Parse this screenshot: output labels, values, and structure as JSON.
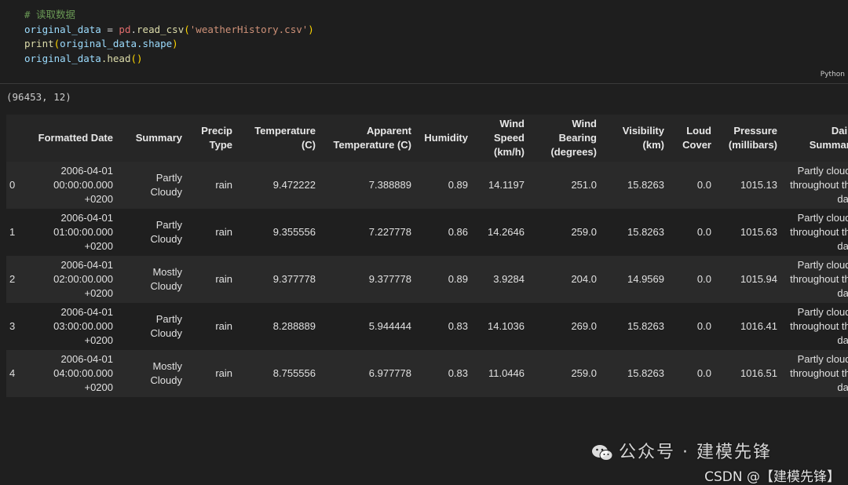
{
  "code": {
    "comment": "# 读取数据",
    "line1": {
      "var": "original_data",
      "op": " = ",
      "mod": "pd",
      "dot": ".",
      "fn": "read_csv",
      "arg": "'weatherHistory.csv'"
    },
    "line2": {
      "fn": "print",
      "var": "original_data",
      "attr": ".shape"
    },
    "line3": {
      "var": "original_data",
      "method": ".head",
      "call": "()"
    },
    "language": "Python"
  },
  "output": {
    "shape": "(96453, 12)",
    "columns": [
      "",
      "Formatted Date",
      "Summary",
      "Precip Type",
      "Temperature (C)",
      "Apparent Temperature (C)",
      "Humidity",
      "Wind Speed (km/h)",
      "Wind Bearing (degrees)",
      "Visibility (km)",
      "Loud Cover",
      "Pressure (millibars)",
      "Daily Summary"
    ],
    "rows": [
      [
        "0",
        "2006-04-01 00:00:00.000 +0200",
        "Partly Cloudy",
        "rain",
        "9.472222",
        "7.388889",
        "0.89",
        "14.1197",
        "251.0",
        "15.8263",
        "0.0",
        "1015.13",
        "Partly cloudy throughout the day."
      ],
      [
        "1",
        "2006-04-01 01:00:00.000 +0200",
        "Partly Cloudy",
        "rain",
        "9.355556",
        "7.227778",
        "0.86",
        "14.2646",
        "259.0",
        "15.8263",
        "0.0",
        "1015.63",
        "Partly cloudy throughout the day."
      ],
      [
        "2",
        "2006-04-01 02:00:00.000 +0200",
        "Mostly Cloudy",
        "rain",
        "9.377778",
        "9.377778",
        "0.89",
        "3.9284",
        "204.0",
        "14.9569",
        "0.0",
        "1015.94",
        "Partly cloudy throughout the day."
      ],
      [
        "3",
        "2006-04-01 03:00:00.000 +0200",
        "Partly Cloudy",
        "rain",
        "8.288889",
        "5.944444",
        "0.83",
        "14.1036",
        "269.0",
        "15.8263",
        "0.0",
        "1016.41",
        "Partly cloudy throughout the day."
      ],
      [
        "4",
        "2006-04-01 04:00:00.000 +0200",
        "Mostly Cloudy",
        "rain",
        "8.755556",
        "6.977778",
        "0.83",
        "11.0446",
        "259.0",
        "15.8263",
        "0.0",
        "1016.51",
        "Partly cloudy throughout the day."
      ]
    ]
  },
  "watermark": {
    "wechat": "公众号 · 建模先锋",
    "csdn": "CSDN @【建模先锋】"
  }
}
